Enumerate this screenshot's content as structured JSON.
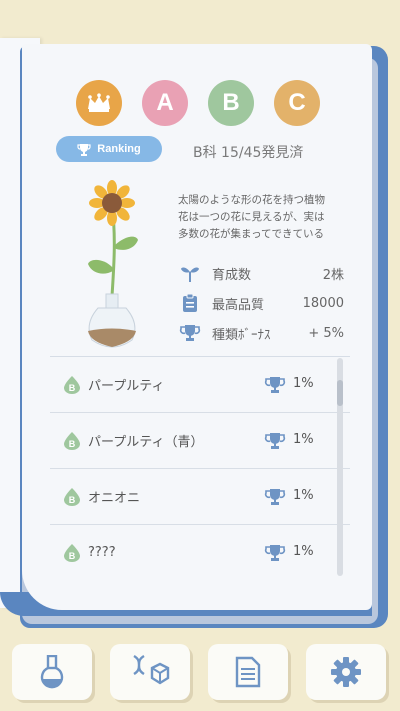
{
  "badges": {
    "crown": "crown-icon",
    "a": "A",
    "b": "B",
    "c": "C"
  },
  "ranking_label": "Ranking",
  "discovered": "B科 15/45発見済",
  "description": [
    "太陽のような形の花を持つ植物",
    "花は一つの花に見えるが、実は",
    "多数の花が集まってできている"
  ],
  "stats": {
    "grow": {
      "label": "育成数",
      "value": "2株"
    },
    "quality": {
      "label": "最高品質",
      "value": "18000"
    },
    "bonus": {
      "label": "種類ﾎﾞｰﾅｽ",
      "value": "+ 5%"
    }
  },
  "list": [
    {
      "name": "パープルティ",
      "pct": "1%"
    },
    {
      "name": "パープルティ（青）",
      "pct": "1%"
    },
    {
      "name": "オニオニ",
      "pct": "1%"
    },
    {
      "name": "????",
      "pct": "1%"
    }
  ],
  "list_grade": "B",
  "colors": {
    "accent_blue": "#5a86c0",
    "ranking_blue": "#86b8e6",
    "badge_green": "#9fc79e",
    "icon_blue": "#6e94c4"
  },
  "nav": [
    "flask-icon",
    "dna-gem-icon",
    "document-icon",
    "gear-icon"
  ]
}
